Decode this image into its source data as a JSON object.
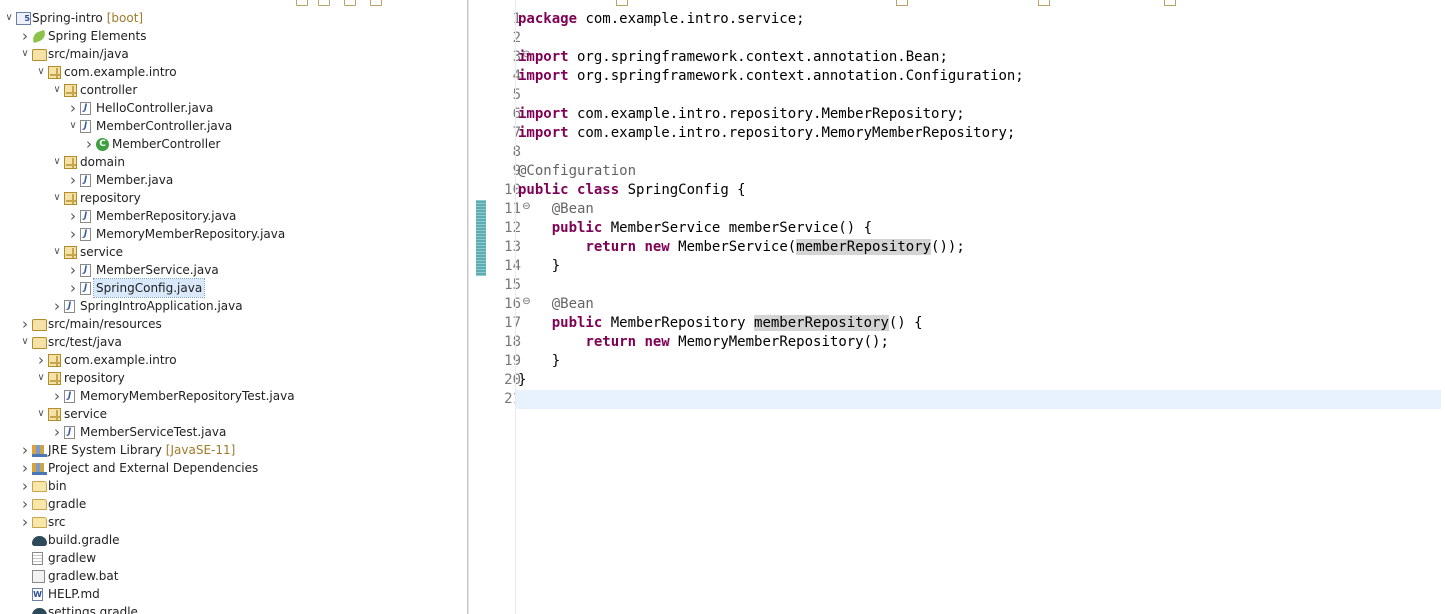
{
  "explorer": {
    "items": [
      {
        "label": "Spring-intro",
        "decoration": "[boot]",
        "icon": "project-icon",
        "expanded": true,
        "depth": 0
      },
      {
        "label": "Spring Elements",
        "icon": "spring-leaf-icon",
        "expanded": false,
        "depth": 1
      },
      {
        "label": "src/main/java",
        "icon": "source-folder-icon",
        "expanded": true,
        "depth": 1
      },
      {
        "label": "com.example.intro",
        "icon": "package-icon",
        "expanded": true,
        "depth": 2
      },
      {
        "label": "controller",
        "icon": "package-icon",
        "expanded": true,
        "depth": 3
      },
      {
        "label": "HelloController.java",
        "icon": "java-file-icon",
        "expanded": false,
        "depth": 4
      },
      {
        "label": "MemberController.java",
        "icon": "java-file-icon",
        "expanded": true,
        "depth": 4
      },
      {
        "label": "MemberController",
        "icon": "class-icon",
        "expanded": false,
        "depth": 5
      },
      {
        "label": "domain",
        "icon": "package-icon",
        "expanded": true,
        "depth": 3
      },
      {
        "label": "Member.java",
        "icon": "java-file-icon",
        "expanded": false,
        "depth": 4
      },
      {
        "label": "repository",
        "icon": "package-icon",
        "expanded": true,
        "depth": 3
      },
      {
        "label": "MemberRepository.java",
        "icon": "java-interface-file-icon",
        "expanded": false,
        "depth": 4
      },
      {
        "label": "MemoryMemberRepository.java",
        "icon": "java-file-icon",
        "expanded": false,
        "depth": 4
      },
      {
        "label": "service",
        "icon": "package-icon",
        "expanded": true,
        "depth": 3
      },
      {
        "label": "MemberService.java",
        "icon": "java-file-icon",
        "expanded": false,
        "depth": 4
      },
      {
        "label": "SpringConfig.java",
        "icon": "java-file-icon",
        "expanded": false,
        "depth": 4,
        "selected": true
      },
      {
        "label": "SpringIntroApplication.java",
        "icon": "java-file-icon",
        "expanded": false,
        "depth": 3
      },
      {
        "label": "src/main/resources",
        "icon": "source-folder-icon",
        "expanded": false,
        "depth": 1
      },
      {
        "label": "src/test/java",
        "icon": "source-folder-icon",
        "expanded": true,
        "depth": 1
      },
      {
        "label": "com.example.intro",
        "icon": "package-icon",
        "expanded": false,
        "depth": 2
      },
      {
        "label": "repository",
        "icon": "package-icon",
        "expanded": true,
        "depth": 2
      },
      {
        "label": "MemoryMemberRepositoryTest.java",
        "icon": "java-file-icon",
        "expanded": false,
        "depth": 3
      },
      {
        "label": "service",
        "icon": "package-icon",
        "expanded": true,
        "depth": 2
      },
      {
        "label": "MemberServiceTest.java",
        "icon": "java-file-icon",
        "expanded": false,
        "depth": 3
      },
      {
        "label": "JRE System Library",
        "decoration": "[JavaSE-11]",
        "icon": "library-icon",
        "expanded": false,
        "depth": 1
      },
      {
        "label": "Project and External Dependencies",
        "icon": "library-icon",
        "expanded": false,
        "depth": 1
      },
      {
        "label": "bin",
        "icon": "folder-icon",
        "expanded": false,
        "depth": 1
      },
      {
        "label": "gradle",
        "icon": "folder-icon",
        "expanded": false,
        "depth": 1
      },
      {
        "label": "src",
        "icon": "folder-icon",
        "expanded": false,
        "depth": 1
      },
      {
        "label": "build.gradle",
        "icon": "gradle-icon",
        "leaf": true,
        "depth": 1
      },
      {
        "label": "gradlew",
        "icon": "text-file-icon",
        "leaf": true,
        "depth": 1
      },
      {
        "label": "gradlew.bat",
        "icon": "batch-file-icon",
        "leaf": true,
        "depth": 1
      },
      {
        "label": "HELP.md",
        "icon": "markdown-file-icon",
        "leaf": true,
        "depth": 1
      },
      {
        "label": "settings.gradle",
        "icon": "gradle-icon",
        "leaf": true,
        "depth": 1
      }
    ]
  },
  "editor": {
    "file": "SpringConfig.java",
    "current_line": 21,
    "folds": [
      3,
      11,
      16
    ],
    "changed_lines": [
      11,
      12,
      13,
      14
    ],
    "lines": [
      [
        {
          "t": "package",
          "c": "kw"
        },
        {
          "t": " com.example.intro.service;"
        }
      ],
      [],
      [
        {
          "t": "import",
          "c": "kw"
        },
        {
          "t": " org.springframework.context.annotation.Bean;"
        }
      ],
      [
        {
          "t": "import",
          "c": "kw"
        },
        {
          "t": " org.springframework.context.annotation.Configuration;"
        }
      ],
      [],
      [
        {
          "t": "import",
          "c": "kw"
        },
        {
          "t": " com.example.intro.repository.MemberRepository;"
        }
      ],
      [
        {
          "t": "import",
          "c": "kw"
        },
        {
          "t": " com.example.intro.repository.MemoryMemberRepository;"
        }
      ],
      [],
      [
        {
          "t": "@Configuration",
          "c": "ann"
        }
      ],
      [
        {
          "t": "public",
          "c": "kw"
        },
        {
          "t": " "
        },
        {
          "t": "class",
          "c": "kw"
        },
        {
          "t": " SpringConfig {"
        }
      ],
      [
        {
          "t": "    "
        },
        {
          "t": "@Bean",
          "c": "ann"
        }
      ],
      [
        {
          "t": "    "
        },
        {
          "t": "public",
          "c": "kw"
        },
        {
          "t": " MemberService memberService() {"
        }
      ],
      [
        {
          "t": "        "
        },
        {
          "t": "return",
          "c": "kw"
        },
        {
          "t": " "
        },
        {
          "t": "new",
          "c": "kw"
        },
        {
          "t": " MemberService("
        },
        {
          "t": "memberRepository",
          "c": "hl"
        },
        {
          "t": "());"
        }
      ],
      [
        {
          "t": "    }"
        }
      ],
      [],
      [
        {
          "t": "    "
        },
        {
          "t": "@Bean",
          "c": "ann"
        }
      ],
      [
        {
          "t": "    "
        },
        {
          "t": "public",
          "c": "kw"
        },
        {
          "t": " MemberRepository "
        },
        {
          "t": "memberRepository",
          "c": "hl"
        },
        {
          "t": "() {"
        }
      ],
      [
        {
          "t": "        "
        },
        {
          "t": "return",
          "c": "kw"
        },
        {
          "t": " "
        },
        {
          "t": "new",
          "c": "kw"
        },
        {
          "t": " MemoryMemberRepository();"
        }
      ],
      [
        {
          "t": "    }"
        }
      ],
      [
        {
          "t": "}"
        }
      ],
      []
    ]
  }
}
